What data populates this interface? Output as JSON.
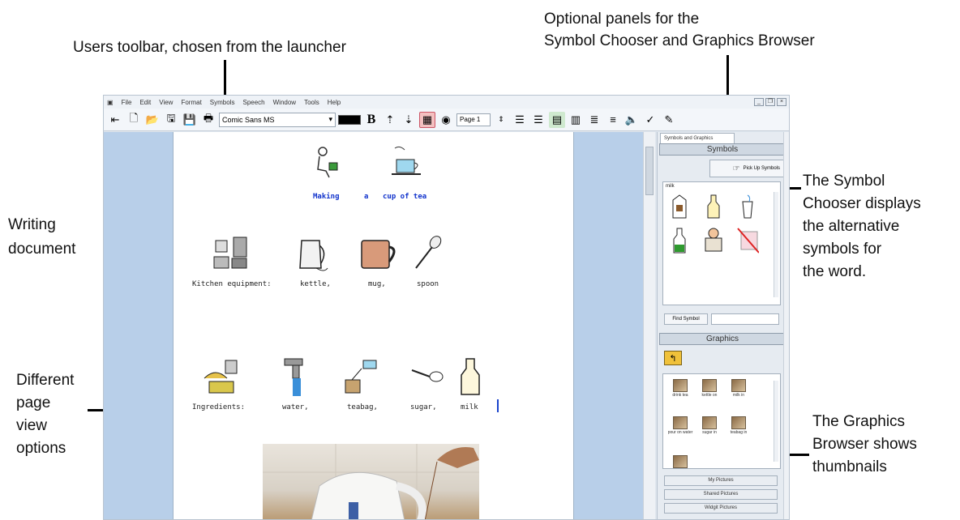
{
  "callouts": {
    "users_toolbar": "Users toolbar, chosen from the launcher",
    "optional_panels_line1": "Optional panels for the",
    "optional_panels_line2": "Symbol Chooser and Graphics Browser",
    "writing_doc_line1": "Writing",
    "writing_doc_line2": "document",
    "page_view_line1": "Different",
    "page_view_line2": "page",
    "page_view_line3": "view",
    "page_view_line4": "options",
    "symbol_chooser_line1": "The Symbol",
    "symbol_chooser_line2": "Chooser displays",
    "symbol_chooser_line3": "the alternative",
    "symbol_chooser_line4": "symbols for",
    "symbol_chooser_line5": "the word.",
    "graphics_browser_line1": "The Graphics",
    "graphics_browser_line2": "Browser shows",
    "graphics_browser_line3": "thumbnails"
  },
  "menu": [
    "File",
    "Edit",
    "View",
    "Format",
    "Symbols",
    "Speech",
    "Window",
    "Tools",
    "Help"
  ],
  "toolbar": {
    "font": "Comic Sans MS",
    "page": "Page 1",
    "bold_label": "B"
  },
  "document": {
    "title_words": [
      "Making",
      "a",
      "cup of tea"
    ],
    "row1_labels": [
      "Kitchen equipment:",
      "kettle,",
      "mug,",
      "spoon"
    ],
    "row2_labels": [
      "Ingredients:",
      "water,",
      "teabag,",
      "sugar,",
      "milk"
    ]
  },
  "panel": {
    "tab": "Symbols and Graphics",
    "symbols_header": "Symbols",
    "pick_up": "Pick Up Symbols",
    "word": "milk",
    "find_symbol": "Find Symbol",
    "graphics_header": "Graphics",
    "thumbnails": [
      "drink tea",
      "kettle on",
      "milk in",
      "pour on water",
      "sugar in",
      "teabag in"
    ],
    "libraries": [
      "My Pictures",
      "Shared Pictures",
      "Widgit Pictures"
    ]
  },
  "colors": {
    "workarea": "#b8cfe9",
    "title_text": "#1133cc",
    "arrow": "#000000"
  }
}
